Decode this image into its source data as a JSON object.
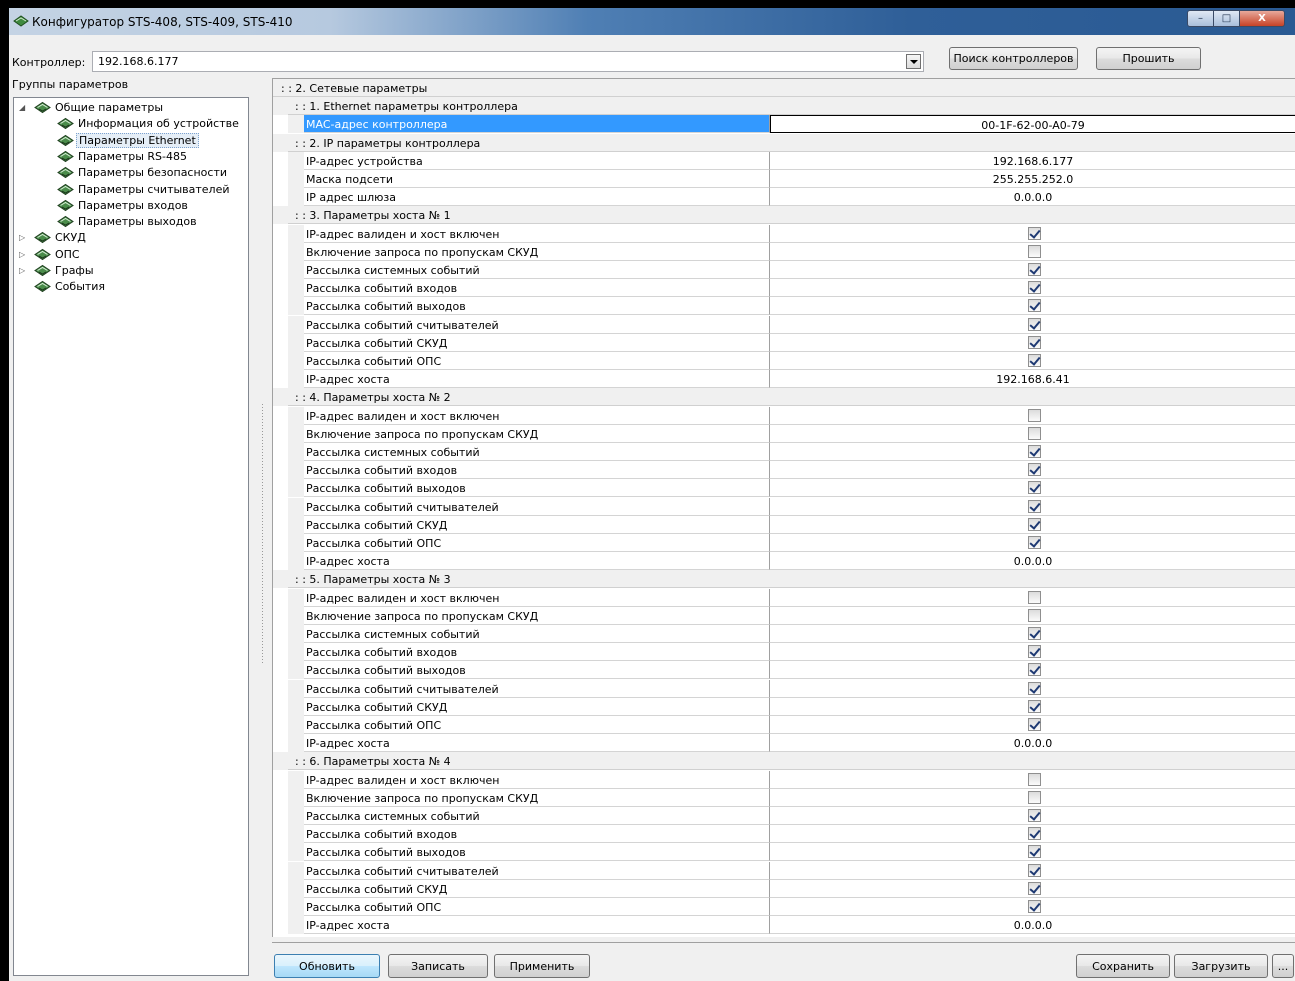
{
  "window": {
    "title": "Конфигуратор STS-408, STS-409, STS-410",
    "minimize": "–",
    "maximize": "□",
    "close": "X"
  },
  "controller": {
    "label": "Контроллер:",
    "value": "192.168.6.177",
    "search_button": "Поиск контроллеров",
    "flash_button": "Прошить"
  },
  "groups": {
    "label": "Группы параметров",
    "items": [
      {
        "label": "Общие параметры",
        "level": 0,
        "expander": "◢",
        "selected": false
      },
      {
        "label": "Информация об устройстве",
        "level": 1,
        "expander": "",
        "selected": false
      },
      {
        "label": "Параметры Ethernet",
        "level": 1,
        "expander": "",
        "selected": true
      },
      {
        "label": "Параметры RS-485",
        "level": 1,
        "expander": "",
        "selected": false
      },
      {
        "label": "Параметры безопасности",
        "level": 1,
        "expander": "",
        "selected": false
      },
      {
        "label": "Параметры считывателей",
        "level": 1,
        "expander": "",
        "selected": false
      },
      {
        "label": "Параметры входов",
        "level": 1,
        "expander": "",
        "selected": false
      },
      {
        "label": "Параметры выходов",
        "level": 1,
        "expander": "",
        "selected": false
      },
      {
        "label": "СКУД",
        "level": 0,
        "expander": "▷",
        "selected": false
      },
      {
        "label": "ОПС",
        "level": 0,
        "expander": "▷",
        "selected": false
      },
      {
        "label": "Графы",
        "level": 0,
        "expander": "▷",
        "selected": false
      },
      {
        "label": "События",
        "level": 0,
        "expander": "",
        "selected": false
      }
    ]
  },
  "grid": {
    "rows": [
      {
        "kind": "cat",
        "level": 0,
        "text": ": : 2. Сетевые параметры"
      },
      {
        "kind": "cat",
        "level": 1,
        "text": ": : 1. Ethernet параметры контроллера"
      },
      {
        "kind": "text",
        "name": "MAC-адрес контроллера",
        "value": "00-1F-62-00-A0-79",
        "selected": true
      },
      {
        "kind": "cat",
        "level": 1,
        "text": ": : 2. IP параметры контроллера"
      },
      {
        "kind": "text",
        "name": "IP-адрес устройства",
        "value": "192.168.6.177"
      },
      {
        "kind": "text",
        "name": "Маска подсети",
        "value": "255.255.252.0"
      },
      {
        "kind": "text",
        "name": "IP адрес шлюза",
        "value": "0.0.0.0"
      },
      {
        "kind": "cat",
        "level": 1,
        "text": ": : 3. Параметры хоста № 1"
      },
      {
        "kind": "check",
        "name": "IP-адрес валиден и хост включен",
        "checked": true
      },
      {
        "kind": "check",
        "name": "Включение запроса по пропускам СКУД",
        "checked": false
      },
      {
        "kind": "check",
        "name": "Рассылка системных событий",
        "checked": true
      },
      {
        "kind": "check",
        "name": "Рассылка событий входов",
        "checked": true
      },
      {
        "kind": "check",
        "name": "Рассылка событий выходов",
        "checked": true
      },
      {
        "kind": "check",
        "name": "Рассылка событий считывателей",
        "checked": true
      },
      {
        "kind": "check",
        "name": "Рассылка событий СКУД",
        "checked": true
      },
      {
        "kind": "check",
        "name": "Рассылка событий ОПС",
        "checked": true
      },
      {
        "kind": "text",
        "name": "IP-адрес хоста",
        "value": "192.168.6.41"
      },
      {
        "kind": "cat",
        "level": 1,
        "text": ": : 4. Параметры хоста № 2"
      },
      {
        "kind": "check",
        "name": "IP-адрес валиден и хост включен",
        "checked": false
      },
      {
        "kind": "check",
        "name": "Включение запроса по пропускам СКУД",
        "checked": false
      },
      {
        "kind": "check",
        "name": "Рассылка системных событий",
        "checked": true
      },
      {
        "kind": "check",
        "name": "Рассылка событий входов",
        "checked": true
      },
      {
        "kind": "check",
        "name": "Рассылка событий выходов",
        "checked": true
      },
      {
        "kind": "check",
        "name": "Рассылка событий считывателей",
        "checked": true
      },
      {
        "kind": "check",
        "name": "Рассылка событий СКУД",
        "checked": true
      },
      {
        "kind": "check",
        "name": "Рассылка событий ОПС",
        "checked": true
      },
      {
        "kind": "text",
        "name": "IP-адрес хоста",
        "value": "0.0.0.0"
      },
      {
        "kind": "cat",
        "level": 1,
        "text": ": : 5. Параметры хоста № 3"
      },
      {
        "kind": "check",
        "name": "IP-адрес валиден и хост включен",
        "checked": false
      },
      {
        "kind": "check",
        "name": "Включение запроса по пропускам СКУД",
        "checked": false
      },
      {
        "kind": "check",
        "name": "Рассылка системных событий",
        "checked": true
      },
      {
        "kind": "check",
        "name": "Рассылка событий входов",
        "checked": true
      },
      {
        "kind": "check",
        "name": "Рассылка событий выходов",
        "checked": true
      },
      {
        "kind": "check",
        "name": "Рассылка событий считывателей",
        "checked": true
      },
      {
        "kind": "check",
        "name": "Рассылка событий СКУД",
        "checked": true
      },
      {
        "kind": "check",
        "name": "Рассылка событий ОПС",
        "checked": true
      },
      {
        "kind": "text",
        "name": "IP-адрес хоста",
        "value": "0.0.0.0"
      },
      {
        "kind": "cat",
        "level": 1,
        "text": ": : 6. Параметры хоста № 4"
      },
      {
        "kind": "check",
        "name": "IP-адрес валиден и хост включен",
        "checked": false
      },
      {
        "kind": "check",
        "name": "Включение запроса по пропускам СКУД",
        "checked": false
      },
      {
        "kind": "check",
        "name": "Рассылка системных событий",
        "checked": true
      },
      {
        "kind": "check",
        "name": "Рассылка событий входов",
        "checked": true
      },
      {
        "kind": "check",
        "name": "Рассылка событий выходов",
        "checked": true
      },
      {
        "kind": "check",
        "name": "Рассылка событий считывателей",
        "checked": true
      },
      {
        "kind": "check",
        "name": "Рассылка событий СКУД",
        "checked": true
      },
      {
        "kind": "check",
        "name": "Рассылка событий ОПС",
        "checked": true
      },
      {
        "kind": "text",
        "name": "IP-адрес хоста",
        "value": "0.0.0.0"
      }
    ]
  },
  "buttons": {
    "refresh": "Обновить",
    "write": "Записать",
    "apply": "Применить",
    "save": "Сохранить",
    "load": "Загрузить",
    "more": "..."
  },
  "colors": {
    "selection": "#3399ff",
    "tree_selection": "#e5eef7",
    "titlebar": "#2f5f98"
  }
}
